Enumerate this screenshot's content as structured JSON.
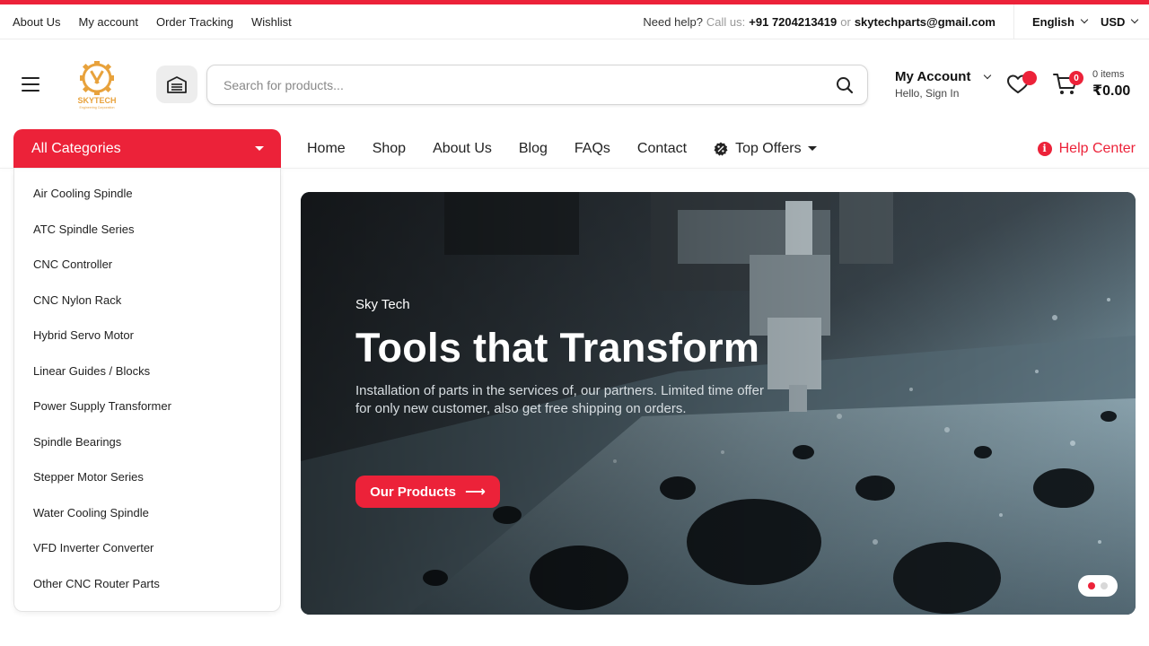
{
  "topbar": {
    "links": [
      "About Us",
      "My account",
      "Order Tracking",
      "Wishlist"
    ],
    "help_prefix": "Need help?",
    "call_us": "Call us:",
    "phone": "+91 7204213419",
    "or": "or",
    "email": "skytechparts@gmail.com",
    "language": "English",
    "currency": "USD"
  },
  "header": {
    "search_placeholder": "Search for products...",
    "account_title": "My Account",
    "account_sub": "Hello, Sign In",
    "cart_count": "0",
    "cart_items": "0 items",
    "cart_total": "₹0.00"
  },
  "nav": {
    "all_categories": "All Categories",
    "items": [
      "Home",
      "Shop",
      "About Us",
      "Blog",
      "FAQs",
      "Contact"
    ],
    "top_offers": "Top Offers",
    "help_center": "Help Center"
  },
  "categories": [
    "Air Cooling Spindle",
    "ATC Spindle Series",
    "CNC Controller",
    "CNC Nylon Rack",
    "Hybrid Servo Motor",
    "Linear Guides / Blocks",
    "Power Supply Transformer",
    "Spindle Bearings",
    "Stepper Motor Series",
    "Water Cooling Spindle",
    "VFD Inverter Converter",
    "Other CNC Router Parts"
  ],
  "hero": {
    "subtitle": "Sky Tech",
    "title": "Tools that Transform",
    "description": "Installation of parts in the services of, our partners. Limited time offer for only new customer, also get free shipping on orders.",
    "button": "Our Products",
    "slide_active": 1,
    "slide_count": 2
  },
  "colors": {
    "accent": "#ec2239",
    "logo": "#e8a23c"
  }
}
